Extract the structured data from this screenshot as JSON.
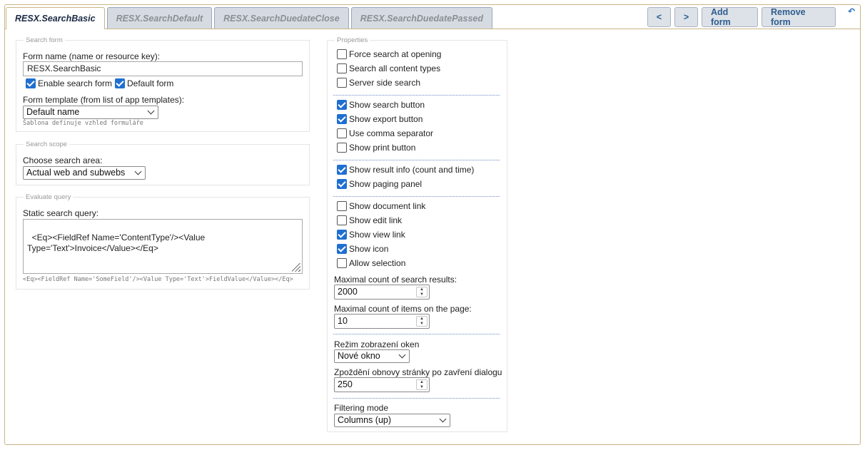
{
  "tabs": [
    {
      "label": "RESX.SearchBasic",
      "active": true
    },
    {
      "label": "RESX.SearchDefault",
      "active": false
    },
    {
      "label": "RESX.SearchDuedateClose",
      "active": false
    },
    {
      "label": "RESX.SearchDuedatePassed",
      "active": false
    }
  ],
  "toolbar": {
    "prev_label": "<",
    "next_label": ">",
    "add_label": "Add form",
    "remove_label": "Remove form",
    "corner_icon": "refresh-icon",
    "corner_glyph": "↶"
  },
  "search_form": {
    "legend": "Search form",
    "form_name_label": "Form name (name or resource key):",
    "form_name_value": "RESX.SearchBasic",
    "enable_label": "Enable search form",
    "enable_checked": true,
    "default_label": "Default form",
    "default_checked": true,
    "template_label": "Form template (from list of app templates):",
    "template_value": "Default name",
    "template_hint": "Šablona definuje vzhled formuláře"
  },
  "search_scope": {
    "legend": "Search scope",
    "area_label": "Choose search area:",
    "area_value": "Actual web and subwebs"
  },
  "evaluate_query": {
    "legend": "Evaluate query",
    "query_label": "Static search query:",
    "query_value": "<Eq><FieldRef Name='ContentType'/><Value Type='Text'>Invoice</Value></Eq>",
    "query_hint": "<Eq><FieldRef Name='SomeField'/><Value Type='Text'>FieldValue</Value></Eq>"
  },
  "properties": {
    "legend": "Properties",
    "checkboxes": [
      {
        "label": "Force search at opening",
        "checked": false
      },
      {
        "label": "Search all content types",
        "checked": false
      },
      {
        "label": "Server side search",
        "checked": false
      },
      {
        "label": "Show search button",
        "checked": true
      },
      {
        "label": "Show export button",
        "checked": true
      },
      {
        "label": "Use comma separator",
        "checked": false
      },
      {
        "label": "Show print button",
        "checked": false
      },
      {
        "label": "Show result info (count and time)",
        "checked": true
      },
      {
        "label": "Show paging panel",
        "checked": true
      },
      {
        "label": "Show document link",
        "checked": false
      },
      {
        "label": "Show edit link",
        "checked": false
      },
      {
        "label": "Show view link",
        "checked": true
      },
      {
        "label": "Show icon",
        "checked": true
      },
      {
        "label": "Allow selection",
        "checked": false
      }
    ],
    "max_results_label": "Maximal count of search results:",
    "max_results_value": "2000",
    "max_items_label": "Maximal count of items on the page:",
    "max_items_value": "10",
    "window_mode_label": "Režim zobrazení oken",
    "window_mode_value": "Nové okno",
    "refresh_delay_label": "Zpoždění obnovy stránky po zavření dialogu",
    "refresh_delay_value": "250",
    "filter_mode_label": "Filtering mode",
    "filter_mode_value": "Columns (up)"
  }
}
